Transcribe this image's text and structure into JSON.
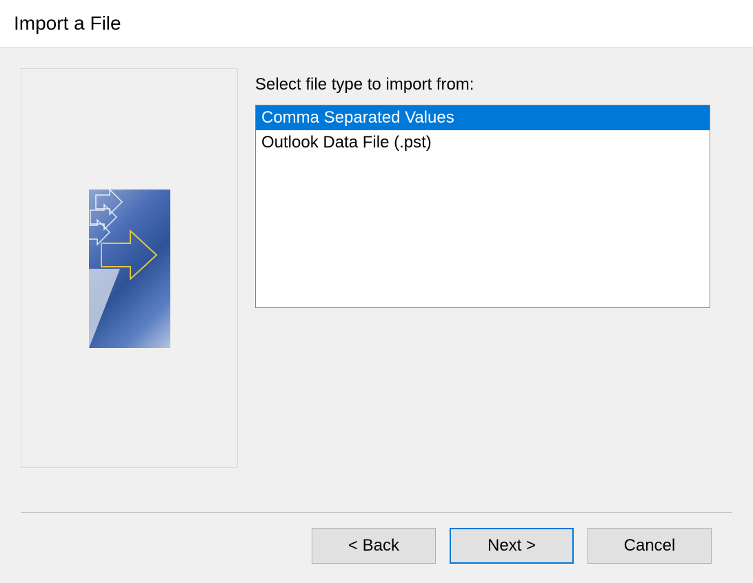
{
  "title": "Import a File",
  "form": {
    "label": "Select file type to import from:",
    "options": [
      {
        "label": "Comma Separated Values",
        "selected": true
      },
      {
        "label": "Outlook Data File (.pst)",
        "selected": false
      }
    ]
  },
  "buttons": {
    "back": "< Back",
    "next": "Next >",
    "cancel": "Cancel"
  }
}
